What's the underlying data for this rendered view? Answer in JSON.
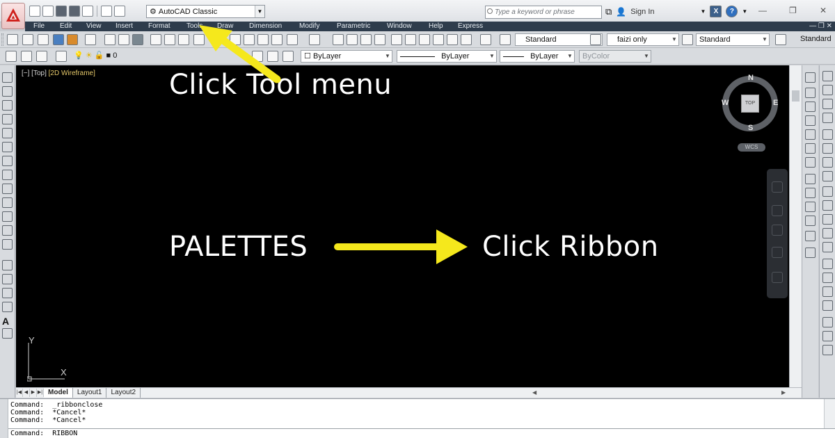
{
  "titlebar": {
    "workspace": "AutoCAD Classic",
    "search_placeholder": "Type a keyword or phrase",
    "signin": "Sign In",
    "exchange_icon": "X",
    "help_icon": "?",
    "icons": [
      "autocad-logo-icon",
      "new-icon",
      "open-icon",
      "save-icon",
      "saveas-icon",
      "plot-icon",
      "undo-icon",
      "redo-icon",
      "binoculars-icon",
      "user-icon",
      "exchange-icon",
      "help-icon",
      "minimize-icon",
      "restore-icon",
      "close-icon"
    ]
  },
  "menu": {
    "items": [
      "File",
      "Edit",
      "View",
      "Insert",
      "Format",
      "Tools",
      "Draw",
      "Dimension",
      "Modify",
      "Parametric",
      "Window",
      "Help",
      "Express"
    ]
  },
  "toolbar": {
    "text_style": "Standard",
    "dim_style": "faizi only",
    "table_style": "Standard",
    "multileader_style": "Standard",
    "layer": "0",
    "color": "ByLayer",
    "linetype": "ByLayer",
    "lineweight": "ByLayer",
    "plot_style": "ByColor"
  },
  "viewport": {
    "label_prefix": "[−] [Top] ",
    "label_visual": "[2D Wireframe]"
  },
  "viewcube": {
    "north": "N",
    "south": "S",
    "east": "E",
    "west": "W",
    "face": "TOP",
    "wcs": "WCS"
  },
  "ucs": {
    "y": "Y",
    "x": "X"
  },
  "annotations": {
    "tool_menu": "Click Tool menu",
    "palettes": "PALETTES",
    "ribbon": "Click Ribbon",
    "color": "#f5e81c"
  },
  "layout_tabs": [
    "Model",
    "Layout1",
    "Layout2"
  ],
  "command_history": [
    "Command:  _ribbonclose",
    "Command:  *Cancel*",
    "Command:  *Cancel*"
  ],
  "command_prompt": "Command:  RIBBON",
  "colors": {
    "canvas": "#000000",
    "menubar": "#2e3c4c",
    "chrome": "#d8dbdf"
  }
}
